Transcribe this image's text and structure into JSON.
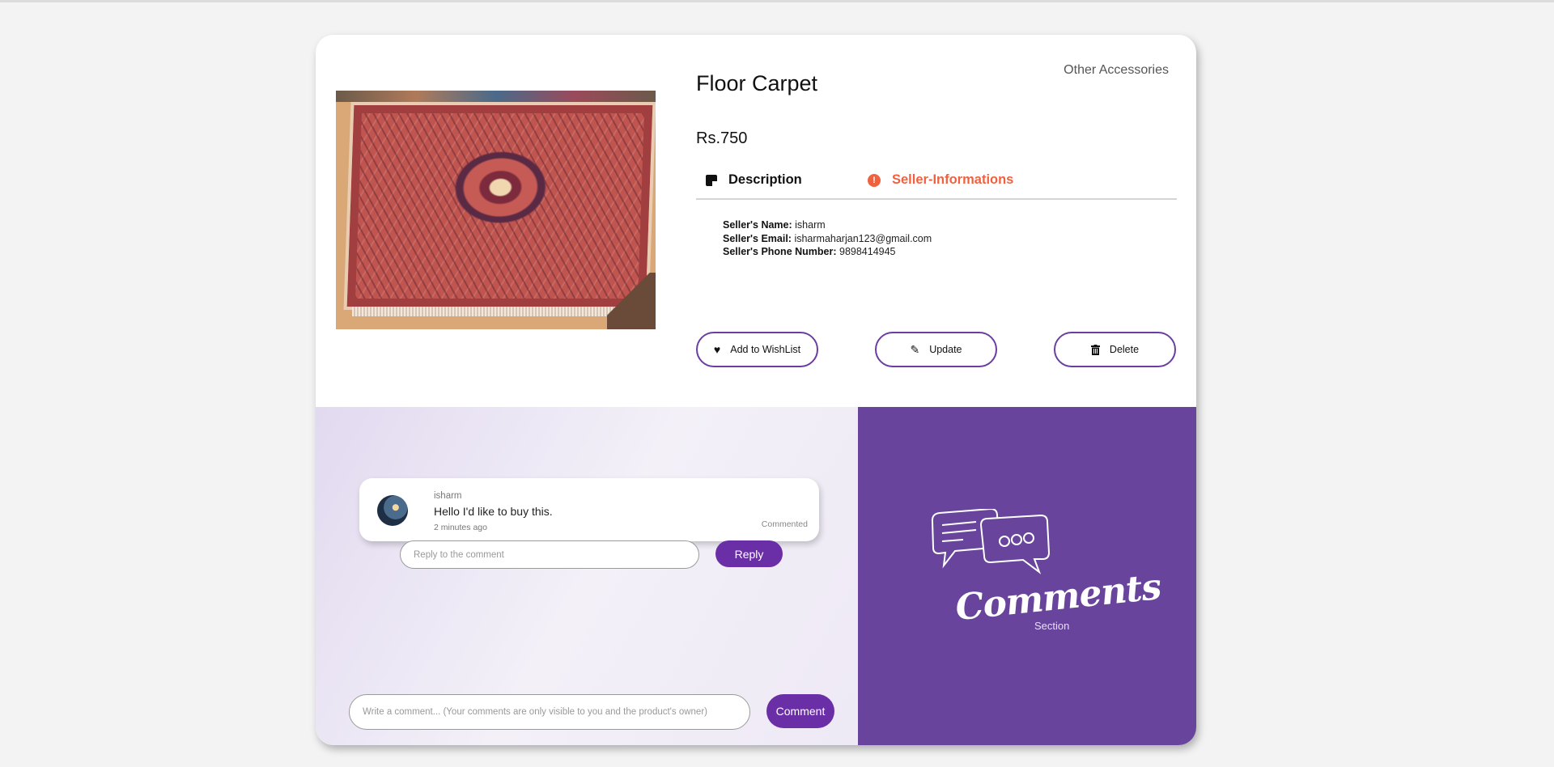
{
  "product": {
    "category": "Other Accessories",
    "title": "Floor Carpet",
    "price": "Rs.750"
  },
  "tabs": [
    {
      "label": "Description",
      "icon": "note-icon"
    },
    {
      "label": "Seller-Informations",
      "icon": "info-icon",
      "color": "#f0623f",
      "active": true
    }
  ],
  "seller": {
    "name_label": "Seller's Name:",
    "name": " isharm",
    "email_label": "Seller's Email:",
    "email": " isharmaharjan123@gmail.com",
    "phone_label": "Seller's Phone Number:",
    "phone": " 9898414945"
  },
  "actions": {
    "wishlist": "Add to WishList",
    "update": "Update",
    "delete": "Delete"
  },
  "comment": {
    "user": "isharm",
    "text": "Hello I'd like to buy this.",
    "time": "2 minutes ago",
    "status": "Commented"
  },
  "reply": {
    "placeholder": "Reply to the comment",
    "button": "Reply"
  },
  "new_comment": {
    "placeholder": "Write a comment... (Your comments are only visible to you and the product's owner)",
    "button": "Comment"
  },
  "side_panel": {
    "title": "Comments",
    "subtitle": "Section"
  },
  "colors": {
    "accent": "#6a2fa6",
    "panel": "#68449c",
    "seller_tab": "#f0623f"
  }
}
